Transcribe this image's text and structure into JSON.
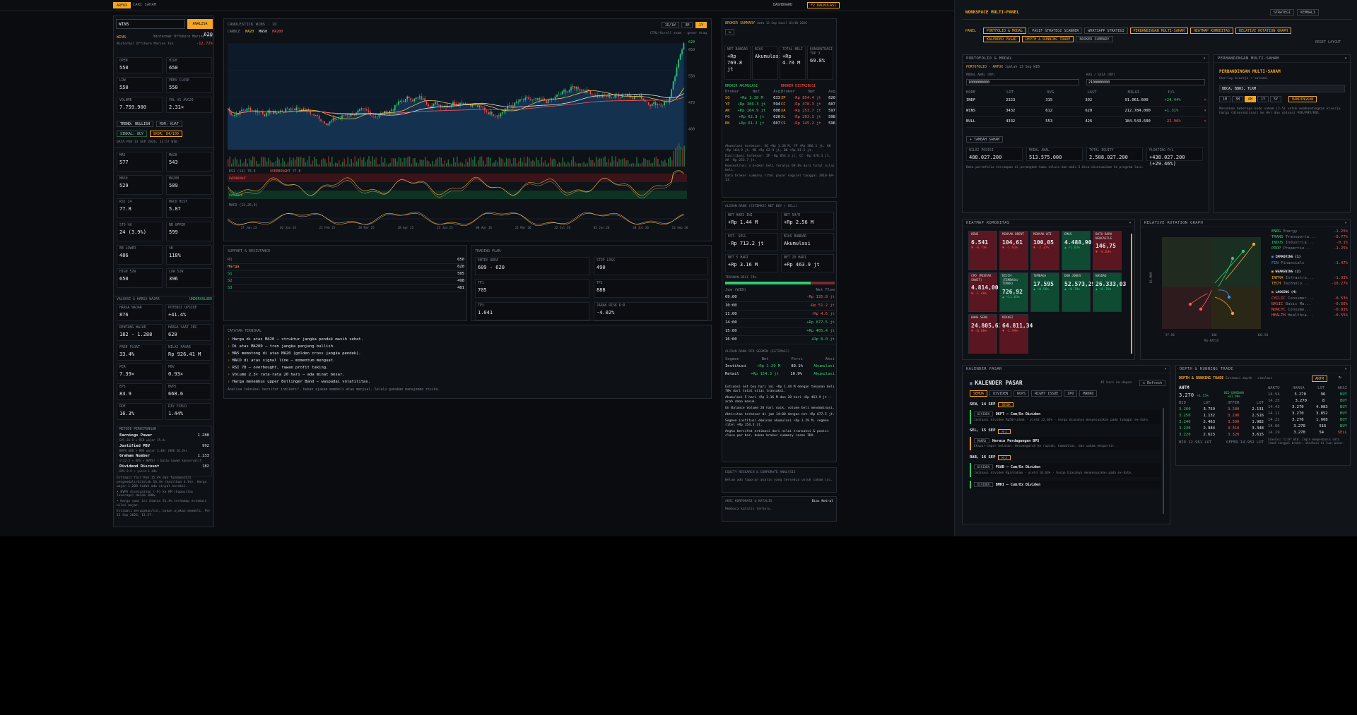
{
  "topbar": {
    "brand": "ARFOX",
    "search_label": "CARI SAHAM",
    "tab_dashboard": "DASHBOARD",
    "tab_calc": "F2 KALKULASI"
  },
  "left": {
    "input_value": "WINS",
    "analyze": "ANALISA",
    "ticker": "WINS",
    "company": "Wintermar Offshore Marine Tbk",
    "sub_company": "Wintermar Offshore Marine Tbk",
    "price": "620",
    "change": "-12.72%",
    "ohlc": [
      {
        "k": "OPEN",
        "v": "550"
      },
      {
        "k": "HIGH",
        "v": "650"
      },
      {
        "k": "LOW",
        "v": "550"
      },
      {
        "k": "PREV CLOSE",
        "v": "550"
      },
      {
        "k": "VOLUME",
        "v": "7.759.900"
      },
      {
        "k": "VOL VS AVG20",
        "v": "2.31×"
      }
    ],
    "trend": "TREND: BULLISH",
    "momentum": "MOM: KUAT",
    "signal": "SINKAL: BUY",
    "score": "SKOR: 84/100",
    "updated": "DATA PER 13 SEP 2026, 13:57 WIB",
    "ma": [
      {
        "k": "MA5",
        "v": "577"
      },
      {
        "k": "MA20",
        "v": "543"
      },
      {
        "k": "MA50",
        "v": "529"
      },
      {
        "k": "MA200",
        "v": "589"
      },
      {
        "k": "RSI 14",
        "v": "77.8"
      },
      {
        "k": "MACD HIST",
        "v": "5.87"
      },
      {
        "k": "STO %K",
        "v": "24 (3.9%)"
      },
      {
        "k": "BB UPPER",
        "v": "599"
      },
      {
        "k": "BB LOWER",
        "v": "486"
      },
      {
        "k": "%B",
        "v": "118%"
      },
      {
        "k": "HIGH 52W",
        "v": "650"
      },
      {
        "k": "LOW 52W",
        "v": "396"
      }
    ],
    "valuation_title": "VALUASI & HARGA WAJAR",
    "valuation_badge": "UNDERVALUED",
    "val": [
      {
        "k": "HARGA WAJAR",
        "v": "876"
      },
      {
        "k": "POTENSI UPSIDE",
        "v": "+41.4%"
      },
      {
        "k": "RENTANG WAJAR",
        "v": "182 - 1.288"
      },
      {
        "k": "HARGA SAAT INI",
        "v": "620"
      },
      {
        "k": "FREE FLOAT",
        "v": "33.4%"
      },
      {
        "k": "NILAI PASAR",
        "v": "Rp 926.41 M"
      },
      {
        "k": "PER",
        "v": "7.39×"
      },
      {
        "k": "PBV",
        "v": "0.93×"
      },
      {
        "k": "EPS",
        "v": "83.9"
      },
      {
        "k": "BVPS",
        "v": "668.6"
      },
      {
        "k": "ROE",
        "v": "16.3%"
      },
      {
        "k": "DIV YIELD",
        "v": "1.44%"
      }
    ],
    "methods_title": "METODE PERHITUNGAN",
    "methods": [
      {
        "k": "Earnings Power",
        "v": "1.288",
        "d": "EPS 83.9 × PER wajar 15.4×"
      },
      {
        "k": "Justified PBV",
        "v": "992",
        "d": "BVPS 668 × PBV wajar 1.48× (ROE 16.3%)"
      },
      {
        "k": "Graham Number",
        "v": "1.133",
        "d": "√(22.5 × EPS × BVPS) — batas bawah konservatif"
      },
      {
        "k": "Dividend Discount",
        "v": "182",
        "d": "DPS 8.9 ÷ yield 1.44%"
      }
    ],
    "notes": [
      "Estimasi fair RoE 15.4% dan fundamental pengendali/ditolak 16.4% (hasilkan 4.1%). Harga wajar 1,288 tidak ada sinyal koreksi.",
      "• BVPS disesuaikan (-9) ke NM (kapasitas leverage) dalam 100%.",
      "• Harga saat ini diatas 41.4% terhadap estimasi nilai wajar.",
      "Estimasi merupakan/ini, bukan ajakan membeli. Per 13 Sep 2026, 13.57."
    ]
  },
  "chart": {
    "title": "CANDLESTICK WINS · 1D",
    "legend": [
      "CANDLE",
      "MA20",
      "MA50",
      "MA200"
    ],
    "tf": [
      "1D/1W",
      "3M",
      "1Y"
    ],
    "hint": "CTRL+Scroll zoom · geser drag",
    "rsi_label": "RSI (14) 78.8",
    "rsi_badge": "OVERBOUGHT 77.8",
    "rsi_ob": "OVERBOUGHT",
    "rsi_os": "OVERSOLD",
    "macd_label": "MACD (12,26,9)",
    "xdates": [
      "27 Jan 23",
      "02 Jan 24",
      "22 Feb 25",
      "20 Mar 25",
      "28 Apr 25",
      "13 Jun 25",
      "08 Apr 26",
      "21 Mar 26",
      "22 Jul 26",
      "02 Jun 26",
      "30 Jul 26",
      "13 Sep 26"
    ],
    "chart_data": {
      "type": "candlestick",
      "series": [
        {
          "name": "MA20"
        },
        {
          "name": "MA50"
        },
        {
          "name": "MA200"
        }
      ],
      "price_levels": [
        "650",
        "550",
        "470",
        "400"
      ],
      "last_price": 620
    }
  },
  "sr": {
    "title": "SUPPORT & RESISTANCE",
    "rows": [
      {
        "k": "R1",
        "v": "650",
        "c": "r"
      },
      {
        "k": "Harga",
        "v": "620",
        "c": "o"
      },
      {
        "k": "S1",
        "v": "505",
        "c": "g"
      },
      {
        "k": "S2",
        "v": "498",
        "c": "g"
      },
      {
        "k": "S3",
        "v": "481",
        "c": "g"
      }
    ]
  },
  "plan": {
    "title": "TRADING PLAN",
    "items": [
      {
        "k": "ENTRY AREA",
        "v": "609 - 620",
        "c": "w"
      },
      {
        "k": "STOP LOSS",
        "v": "490",
        "c": "r"
      },
      {
        "k": "TP1",
        "v": "705",
        "c": "g"
      },
      {
        "k": "TP2",
        "v": "888",
        "c": "g"
      },
      {
        "k": "TP3",
        "v": "1.041",
        "c": "g"
      },
      {
        "k": "JARAK RISK R:R",
        "v": "-4.02%",
        "c": "r"
      }
    ]
  },
  "tech": {
    "title": "CATATAN TEKNIKAL",
    "lines": [
      "Harga di atas MA20 — struktur jangka pendek masih sehat.",
      "Di atas MA200 — tren jangka panjang bullish.",
      "MA5 memotong di atas MA20 (golden cross jangka pendek).",
      "MACD di atas signal line — momentum menguat.",
      "RSI 78 — overbought, rawan profit taking.",
      "Volume 2.3× rata-rata 20 hari — ada minat besar.",
      "Harga menembus upper Bollinger Band — waspadai volatilitas."
    ],
    "foot": "Analisa teknikal bersifat indikatif, bukan ajakan membeli atau menjual. Selalu gunakan manajemen risiko."
  },
  "broker": {
    "title": "BROKER SUMMARY",
    "sub": "data 13 Sep hasil 03/10 2026",
    "kpis": [
      {
        "k": "NET BANDAR",
        "v": "+Rp 769.8 jt",
        "c": "g"
      },
      {
        "k": "BIAS",
        "v": "Akumulasi",
        "c": "g"
      },
      {
        "k": "TOTAL BELI",
        "v": "+Rp 4.70 M",
        "c": "g"
      },
      {
        "k": "KONSENTRASI TOP 3",
        "v": "69.8%",
        "c": "w"
      }
    ],
    "buy_title": "BROKER AKUMULASI",
    "sell_title": "BROKER DISTRIBUSI",
    "cols": [
      "Broker",
      "Net",
      "Avg"
    ],
    "buy": [
      {
        "b": "SQ",
        "n": "+Rp 1.38 M",
        "a": "633"
      },
      {
        "b": "YP",
        "n": "+Rp 386.3 jt",
        "a": "594"
      },
      {
        "b": "AK",
        "n": "+Rp 164.9 jt",
        "a": "608"
      },
      {
        "b": "PG",
        "n": "+Rp 62.9 jt",
        "a": "620"
      },
      {
        "b": "BK",
        "n": "+Rp 61.2 jt",
        "a": "607"
      }
    ],
    "sell": [
      {
        "b": "ZP",
        "n": "-Rp 854.4 jt",
        "a": "620"
      },
      {
        "b": "CC",
        "n": "-Rp 478.3 jt",
        "a": "607"
      },
      {
        "b": "XA",
        "n": "-Rp 253.7 jt",
        "a": "597"
      },
      {
        "b": "XL",
        "n": "-Rp 203.3 jt",
        "a": "598"
      },
      {
        "b": "CS",
        "n": "-Rp 145.2 jt",
        "a": "596"
      }
    ],
    "notes": [
      "Akumulasi terbesar: SQ +Rp 1.38 M, YP +Rp 386.3 jt, AK +Rp 164.9 jt. MG +Rp 62.9 jt, BK +Rp 61.2 jt.",
      "Distribusi terbesar: ZP -Rp 854.4 jt, CC -Rp 478.3 jt, XA -Rp 253.7 jt.",
      "Konsentrasi 3 broker beli teratas 69.8% dari total nilai beli.",
      "Data broker summary ritel pasar reguler tanggal 2010-09-13."
    ]
  },
  "flow": {
    "title": "ALIRAN DANA (ESTIMASI NET BUY / SELL)",
    "tiles": [
      {
        "k": "NET HARI INI",
        "v": "+Rp 1.44 M",
        "c": "g"
      },
      {
        "k": "NET 5H/R",
        "v": "+Rp 2.56 M",
        "c": "g"
      },
      {
        "k": "EST. SELL",
        "v": "-Rp 713.2 jt",
        "c": "r"
      },
      {
        "k": "BIAS BANDAR",
        "v": "Akumulasi",
        "c": "g"
      },
      {
        "k": "NET 5 HARI",
        "v": "+Rp 3.16 M",
        "c": "g"
      },
      {
        "k": "NET 20 HARI",
        "v": "+Rp 463.9 jt",
        "c": "g"
      }
    ],
    "tekanan_title": "TEKANAN BELI 78%",
    "tekanan": 0.78,
    "cols": [
      "Jam (WIB)",
      "Net Flow"
    ],
    "rows": [
      {
        "t": "09:00",
        "v": "-Rp 135.8 jt"
      },
      {
        "t": "10:00",
        "v": "-Rp 51.2 jt"
      },
      {
        "t": "11:00",
        "v": "-Rp 4.6 jt"
      },
      {
        "t": "14:00",
        "v": "+Rp 677.5 jt"
      },
      {
        "t": "15:00",
        "v": "+Rp 405.4 jt"
      },
      {
        "t": "16:00",
        "v": "+Rp 8.0 jt"
      }
    ],
    "seg_title": "ALIRAN DANA PER SEGMEN (ESTIMASI)",
    "seg_cols": [
      "Segmen",
      "Net",
      "Porsi",
      "Aksi"
    ],
    "segs": [
      {
        "s": "Institusi",
        "n": "+Rp 1.29 M",
        "p": "89.1%",
        "a": "Akumulasi"
      },
      {
        "s": "Retail",
        "n": "+Rp 154.3 jt",
        "p": "10.9%",
        "a": "Akumulasi"
      }
    ],
    "notes": [
      "Estimasi net buy hari ini +Rp 1.44 M dengan tekanan beli 78% dari total nilai transaksi.",
      "Akumulasi 5 hari +Rp 3.16 M dan 20 hari +Rp 463.9 jt — arah dana masuk.",
      "On Balance Volume 20 hari naik, volume beli mendominasi.",
      "Aktivitas terbesar di jam 14:00 dengan net +Rp 677.5 jt.",
      "Segmen institusi dominan akumulasi +Rp 1.29 M, segmen ritel +Rp 154.3 jt.",
      "Angka bersifat estimasi dari nilai transaksi & posisi close per bar, bukan broker summary resmi IDX."
    ]
  },
  "equity": {
    "title": "EQUITY RESEARCH & CORPORATE ANALYSIS",
    "text": "Belum ada laporan analis yang tersedia untuk saham ini."
  },
  "corp": {
    "title": "AKSI KORPORASI & KATALIS",
    "badge": "Bias Netral",
    "text": "Membaca katalis terbaru."
  },
  "ws": {
    "title": "WORKSPACE MULTI-PANEL",
    "btn1": "STRATEGI",
    "btn2": "KEMBALI",
    "panel_label": "PANEL",
    "chips": [
      "PORTFOLIO & MODAL",
      "PASIF STRATEGI SCANNER",
      "WHATSAPP STRATEGI",
      "PERBANDINGAN MULTI-SAHAM",
      "HEATMAP KOMODITAS",
      "RELATIVE ROTATION GRAPH",
      "KALENDER PASAR",
      "DEPTH & RUNNING TRADE",
      "BROKER SUMMARY"
    ],
    "reset": "RESET LAYOUT"
  },
  "pf": {
    "title": "PORTOFOLIO & MODAL",
    "sub": "PORTOFOLIO · ARFOX",
    "sub2": "Jumlah 13 Sep WIB",
    "mod_label": "MODAL AWAL (RP)",
    "mod": "1000000000",
    "cash_label": "KAS / SISA (RP)",
    "cash": "2100000000",
    "cols": [
      "KODE",
      "LOT",
      "AVG",
      "LAST",
      "NILAI",
      "P/L"
    ],
    "rows": [
      {
        "c": "INDF",
        "l": "2323",
        "a": "315",
        "s": "392",
        "n": "91.061.600",
        "p": "+24.44%",
        "pc": "g"
      },
      {
        "c": "WINS",
        "l": "3432",
        "a": "612",
        "s": "620",
        "n": "212.784.000",
        "p": "+1.31%",
        "pc": "g"
      },
      {
        "c": "BULL",
        "l": "4332",
        "a": "553",
        "s": "426",
        "n": "184.543.600",
        "p": "-22.96%",
        "pc": "r"
      }
    ],
    "add": "+ TAMBAH SAHAM",
    "sum": [
      {
        "k": "NILAI POSISI",
        "v": "488.027.200",
        "c": "w"
      },
      {
        "k": "MODAL AWAL",
        "v": "513.575.000",
        "c": "w"
      },
      {
        "k": "TOTAL EQUITY",
        "v": "2.588.027.200",
        "c": "w"
      },
      {
        "k": "FLOATING P/L",
        "v": "+438.027.200 (+29.46%)",
        "c": "g"
      }
    ],
    "foot": "Data portofolio tersimpan di perangkat kamu selain dan maks 3 bisa disesuaikan ke program lain."
  },
  "cmp": {
    "title": "PERBANDINGAN MULTI-SAHAM",
    "heading": "PERBANDINGAN MULTI-SAHAM",
    "sub": "Overlay kinerja + valuasi",
    "input": "BBCA, BBRI, TLKM",
    "tfs": [
      "1M",
      "3M",
      "6M",
      "1Y",
      "5Y"
    ],
    "run": "BANDINGKAN",
    "text": "Masukkan beberapa kode saham (2-5) untuk membandingkan kinerja harga (dinormalisasi ke 0%) dan valuasi PER/PBV/ROE."
  },
  "heat": {
    "title": "HEATMAP KOMODITAS",
    "cells": [
      {
        "n": "WINS",
        "p": "6.541",
        "c": "▼ -0.73%",
        "bg": "red"
      },
      {
        "n": "MINYAK BRENT",
        "p": "104,61",
        "c": "▼ -1.81%",
        "bg": "red"
      },
      {
        "n": "MINYAK WTI",
        "p": "100,05",
        "c": "▼ -2.37%",
        "bg": "red"
      },
      {
        "n": "EMAS",
        "p": "4.488,90",
        "c": "▲ +1.02%",
        "bg": "grn"
      },
      {
        "n": "BATU BARA NEWCASTLE",
        "p": "146,75",
        "c": "▼ -0.84%",
        "bg": "red"
      },
      {
        "n": "CPO (MINYAK SAWIT)",
        "p": "4.814,00",
        "c": "▼ -1.40%",
        "bg": "red"
      },
      {
        "n": "BIJIH (TEMBAGA/ TIMAH)",
        "p": "726,92",
        "c": "▲ +11.03%",
        "bg": "grn"
      },
      {
        "n": "TEMBAGA",
        "p": "17.595",
        "c": "▲ +0.56%",
        "bg": "grn"
      },
      {
        "n": "DOW JONES",
        "p": "52.573,29",
        "c": "▲ +0.70%",
        "bg": "grn"
      },
      {
        "n": "NASDAQ",
        "p": "26.333,03",
        "c": "▲ +0.76%",
        "bg": "grn"
      },
      {
        "n": "HANG SENG",
        "p": "24.805,63",
        "c": "▼ -0.60%",
        "bg": "red"
      },
      {
        "n": "NIKKEI",
        "p": "64.811,34",
        "c": "▼ -1.99%",
        "bg": "red"
      }
    ]
  },
  "rrg": {
    "title": "RELATIVE ROTATION GRAPH",
    "xlabel": "RS-RATIO",
    "ylabel": "RS-MOM",
    "xticks": [
      "97.50",
      "100",
      "102.50"
    ],
    "leading": [
      {
        "n": "ENRG",
        "s": "Energy",
        "v": "-1.25%"
      },
      {
        "n": "TRANS",
        "s": "Transporta...",
        "v": "-0.77%"
      },
      {
        "n": "INDUS",
        "s": "Industria...",
        "v": "-0.1%"
      },
      {
        "n": "PROP",
        "s": "Propertie...",
        "v": "-1.25%"
      }
    ],
    "improving_title": "IMPROVING (1)",
    "improving": [
      {
        "n": "FIN",
        "s": "Financials",
        "v": "-1.47%"
      }
    ],
    "weakening_title": "WEAKENING (2)",
    "weakening": [
      {
        "n": "INFRA",
        "s": "Infrastru...",
        "v": "-1.33%"
      },
      {
        "n": "TECH",
        "s": "Technolo...",
        "v": "-10.27%"
      }
    ],
    "lagging_title": "LAGGING (4)",
    "lagging": [
      {
        "n": "CYCLIC",
        "s": "Consumer...",
        "v": "-0.53%"
      },
      {
        "n": "BASIC",
        "s": "Basic Ma...",
        "v": "-0.66%"
      },
      {
        "n": "NONCYC",
        "s": "Consume...",
        "v": "-0.83%"
      },
      {
        "n": "HEALTH",
        "s": "Healthca...",
        "v": "-0.55%"
      }
    ]
  },
  "kal": {
    "title": "KALENDER PASAR",
    "heading": "KALENDER PASAR",
    "range": "45 hari ke depan",
    "refresh": "↻ Refresh",
    "tabs": [
      "SEMUA",
      "DIVIDEN",
      "RUPS",
      "RIGHT ISSUE",
      "IPO",
      "MAKRO"
    ],
    "groups": [
      {
        "d": "SEN, 14 SEP",
        "tag": "BESOK",
        "items": [
          {
            "t": "DIVIDEN",
            "n": "DKFT — Cum/Ex Dividen",
            "d": "Indikasi dividen Rp50/saham · yield 12.03% · harga biasanya menyesuaikan pada tanggal ex-date."
          }
        ]
      },
      {
        "d": "SEL, 15 SEP",
        "tag": "H-2",
        "items": [
          {
            "t": "MAKRO",
            "n": "Neraca Perdagangan BPS",
            "d": "Ekspor-impor bulanan. Berpengaruh ke rupiah, komoditas, dan saham eksportir."
          }
        ]
      },
      {
        "d": "RAB, 16 SEP",
        "tag": "H-3",
        "items": [
          {
            "t": "DIVIDEN",
            "n": "PSAB — Cum/Ex Dividen",
            "d": "Indikasi dividen Rp3/saham · yield 10.63% · harga biasanya menyesuaikan pada ex-date."
          },
          {
            "t": "DIVIDEN",
            "n": "BMRI — Cum/Ex Dividen",
            "d": ""
          }
        ]
      }
    ]
  },
  "depth": {
    "title": "DEPTH & RUNNING TRADE",
    "heading": "DEPTH & RUNNING TRADE",
    "sub": "Estimasi depth · simulasi",
    "sel": "ANTM",
    "ticker": "ANTM",
    "price": "3.270",
    "chg": "+1.55%",
    "badge1": "BID DOMINAN",
    "badge2": "+61.98%",
    "cols": [
      "BID",
      "LOT",
      "OFFER",
      "LOT"
    ],
    "book": [
      {
        "b": "3.260",
        "bl": "3.759",
        "o": "3.280",
        "ol": "2.131"
      },
      {
        "b": "3.250",
        "bl": "1.132",
        "o": "3.290",
        "ol": "2.516"
      },
      {
        "b": "3.240",
        "bl": "2.463",
        "o": "3.300",
        "ol": "1.982"
      },
      {
        "b": "3.230",
        "bl": "2.984",
        "o": "3.310",
        "ol": "3.348"
      },
      {
        "b": "3.220",
        "bl": "2.623",
        "o": "3.320",
        "ol": "3.615"
      }
    ],
    "total_bid": "BID 12.961 LOT",
    "total_off": "OFFER 14.952 LOT",
    "rt_cols": [
      "WAKTU",
      "HARGA",
      "LOT",
      "AKSI"
    ],
    "trades": [
      {
        "t": "14.54",
        "p": "3.270",
        "l": "96",
        "a": "BUY"
      },
      {
        "t": "14.25",
        "p": "3.270",
        "l": "8",
        "a": "BUY"
      },
      {
        "t": "14.43",
        "p": "3.270",
        "l": "4.083",
        "a": "BUY"
      },
      {
        "t": "14.11",
        "p": "3.270",
        "l": "3.852",
        "a": "BUY"
      },
      {
        "t": "14.22",
        "p": "3.270",
        "l": "1.008",
        "a": "BUY"
      },
      {
        "t": "14.00",
        "p": "3.270",
        "l": "516",
        "a": "BUY"
      },
      {
        "t": "14.19",
        "p": "3.270",
        "l": "54",
        "a": "SELL"
      }
    ],
    "note": "Simulasi 12:07 WIB. Ingin memperbarui data lewat tanggal broker, eksekusi di luar pasar."
  }
}
